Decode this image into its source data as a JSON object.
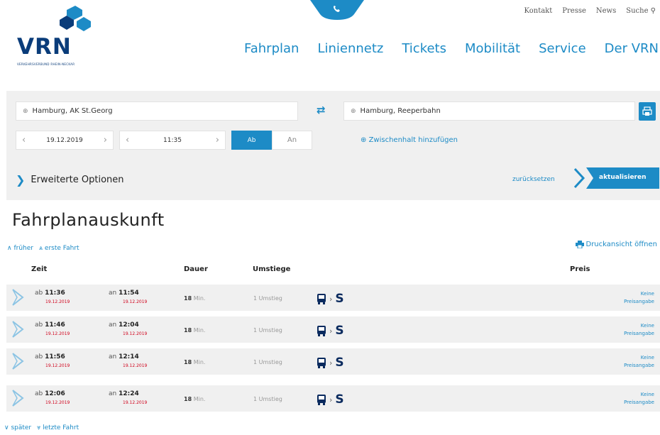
{
  "brand": {
    "name": "VRN",
    "tagline": "VERKEHRSVERBUND RHEIN-NECKAR",
    "accent": "#1d8bc6",
    "dark": "#0a3c7a"
  },
  "top_links": [
    "Kontakt",
    "Presse",
    "News",
    "Suche"
  ],
  "main_nav": [
    "Fahrplan",
    "Liniennetz",
    "Tickets",
    "Mobilität",
    "Service",
    "Der VRN"
  ],
  "search": {
    "from": "Hamburg, AK St.Georg",
    "to": "Hamburg, Reeperbahn",
    "date": "19.12.2019",
    "time": "11:35",
    "depart_label": "Ab",
    "arrive_label": "An",
    "via_label": "Zwischenhalt hinzufügen",
    "extended_options": "Erweiterte Optionen",
    "reset_label": "zurücksetzen",
    "update_label": "aktualisieren"
  },
  "results": {
    "title": "Fahrplanauskunft",
    "earlier_label": "früher",
    "first_trip_label": "erste Fahrt",
    "later_label": "später",
    "last_trip_label": "letzte Fahrt",
    "print_view_label": "Druckansicht öffnen",
    "columns": {
      "time": "Zeit",
      "duration": "Dauer",
      "changes": "Umstiege",
      "price": "Preis"
    },
    "rows": [
      {
        "dep_prefix": "ab",
        "dep_time": "11:36",
        "dep_date": "19.12.2019",
        "arr_prefix": "an",
        "arr_time": "11:54",
        "arr_date": "19.12.2019",
        "duration": "18",
        "duration_unit": "Min.",
        "changes_count": "1",
        "changes_label": "Umstieg",
        "mode_s": "S",
        "price_line1": "Keine",
        "price_line2": "Preisangabe"
      },
      {
        "dep_prefix": "ab",
        "dep_time": "11:46",
        "dep_date": "19.12.2019",
        "arr_prefix": "an",
        "arr_time": "12:04",
        "arr_date": "19.12.2019",
        "duration": "18",
        "duration_unit": "Min.",
        "changes_count": "1",
        "changes_label": "Umstieg",
        "mode_s": "S",
        "price_line1": "Keine",
        "price_line2": "Preisangabe"
      },
      {
        "dep_prefix": "ab",
        "dep_time": "11:56",
        "dep_date": "19.12.2019",
        "arr_prefix": "an",
        "arr_time": "12:14",
        "arr_date": "19.12.2019",
        "duration": "18",
        "duration_unit": "Min.",
        "changes_count": "1",
        "changes_label": "Umstieg",
        "mode_s": "S",
        "price_line1": "Keine",
        "price_line2": "Preisangabe"
      },
      {
        "dep_prefix": "ab",
        "dep_time": "12:06",
        "dep_date": "19.12.2019",
        "arr_prefix": "an",
        "arr_time": "12:24",
        "arr_date": "19.12.2019",
        "duration": "18",
        "duration_unit": "Min.",
        "changes_count": "1",
        "changes_label": "Umstieg",
        "mode_s": "S",
        "price_line1": "Keine",
        "price_line2": "Preisangabe"
      }
    ]
  }
}
